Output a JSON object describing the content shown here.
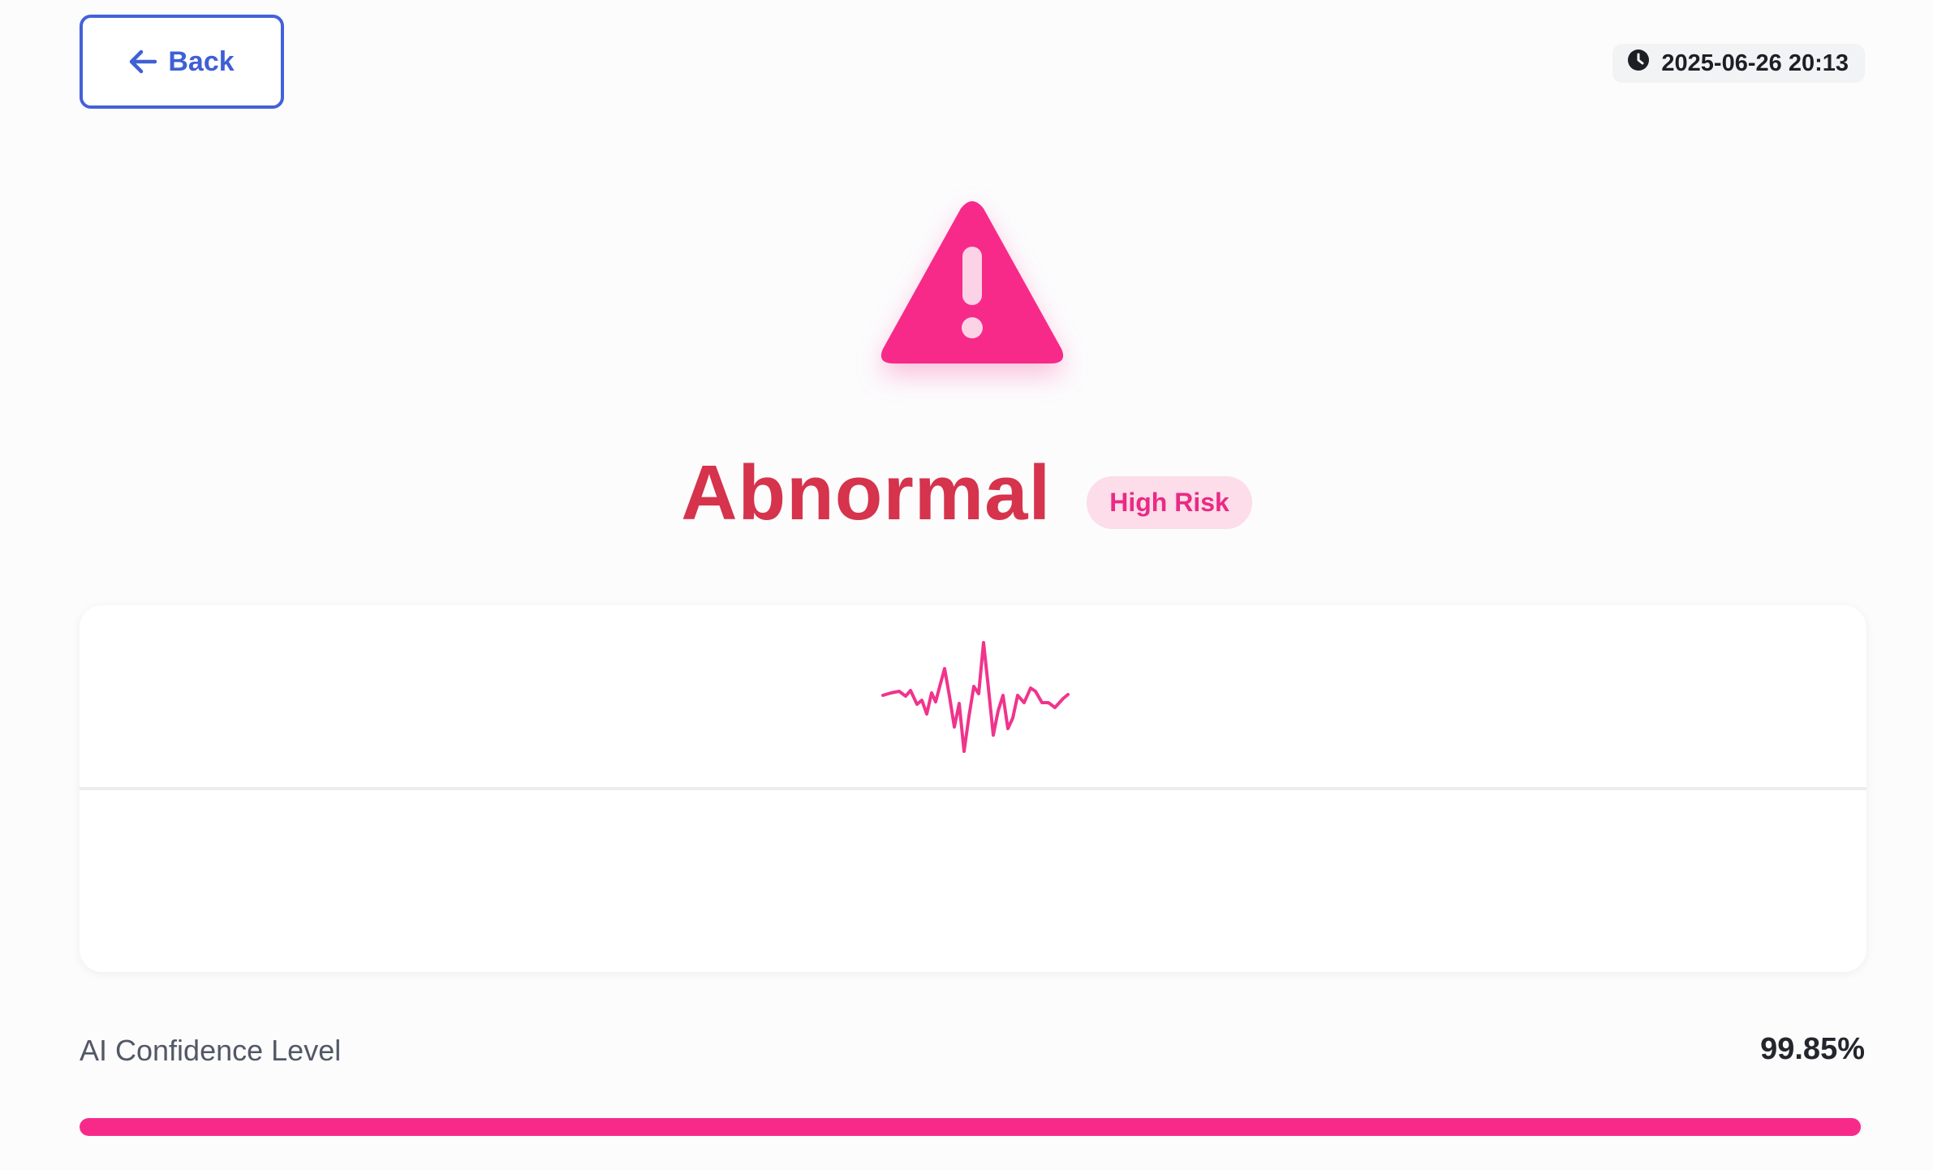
{
  "header": {
    "back_label": "Back",
    "timestamp": "2025-06-26 20:13"
  },
  "icons": {
    "back": "arrow-left-icon",
    "clock": "clock-icon",
    "warning": "warning-triangle-icon",
    "ecg": "ecg-waveform-icon"
  },
  "result": {
    "status": "Abnormal",
    "risk": "High Risk"
  },
  "confidence": {
    "label": "AI Confidence Level",
    "value_text": "99.85%",
    "fraction": 0.9985
  },
  "colors": {
    "accent": "#4361d8",
    "status_text": "#d6334d",
    "danger": "#f72a8a",
    "badge_bg": "#fcdde9"
  }
}
